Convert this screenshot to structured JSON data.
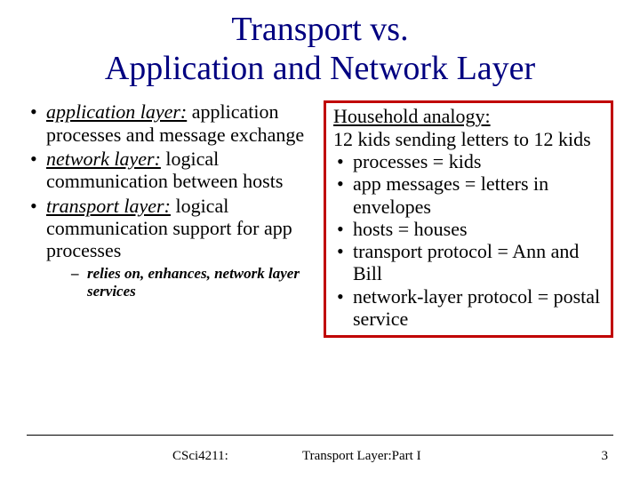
{
  "title": "Transport vs.\nApplication and Network Layer",
  "left": {
    "b1_term": "application layer:",
    "b1_rest": " application processes and message exchange",
    "b2_term": "network layer:",
    "b2_rest": " logical communication between hosts",
    "b3_term": "transport layer:",
    "b3_rest": " logical communication support for app processes",
    "sub1": "relies on, enhances, network layer services"
  },
  "right": {
    "heading": "Household analogy:",
    "subtitle": "12 kids sending letters to 12 kids",
    "items": {
      "i1": "processes = kids",
      "i2": "app messages = letters in envelopes",
      "i3": "hosts = houses",
      "i4": "transport protocol = Ann and Bill",
      "i5": "network-layer protocol = postal service"
    }
  },
  "footer": {
    "course": "CSci4211:",
    "section": "Transport Layer:Part I",
    "page": "3"
  }
}
